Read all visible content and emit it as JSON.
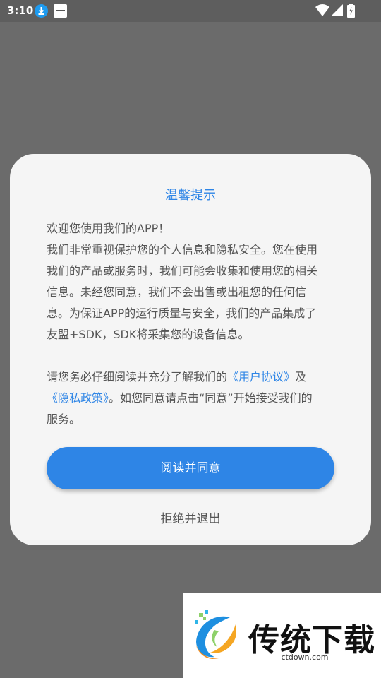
{
  "status_bar": {
    "time": "3:10",
    "icons": [
      "download-icon",
      "app-notification-icon",
      "wifi-icon",
      "signal-icon",
      "battery-icon"
    ]
  },
  "dialog": {
    "title": "温馨提示",
    "paragraph1_lines": [
      "欢迎您使用我们的APP！",
      "我们非常重视保护您的个人信息和隐私安全。您在使用",
      "我们的产品或服务时，我们可能会收集和使用您的相关",
      "信息。未经您同意，我们不会出售或出租您的任何信",
      "息。为保证APP的运行质量与安全，我们的产品集成了",
      "友盟+SDK，SDK将采集您的设备信息。"
    ],
    "paragraph2": {
      "line1_prefix": "请您务必仔细阅读并充分了解我们的",
      "user_agreement_link": "《用户协议》",
      "line1_suffix": "及",
      "privacy_policy_link": "《隐私政策》",
      "line2_suffix": "。如您同意请点击“同意”开始接受我们的",
      "line3": "服务。"
    },
    "agree_button": "阅读并同意",
    "exit_button": "拒绝并退出"
  },
  "watermark": {
    "name": "传统下载",
    "url": "ctdown.com"
  },
  "colors": {
    "accent": "#2e85e6",
    "overlay": "#6b6b6b",
    "dialog_bg": "#f5f5f5"
  }
}
